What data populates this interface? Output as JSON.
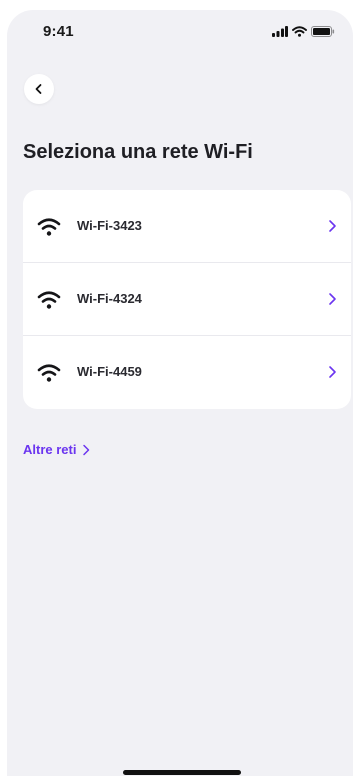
{
  "status_bar": {
    "time": "9:41",
    "icons": [
      "signal-icon",
      "wifi-icon",
      "battery-icon"
    ]
  },
  "header": {
    "back_icon": "chevron-left-icon",
    "title": "Seleziona una rete Wi-Fi"
  },
  "networks": [
    {
      "name": "Wi-Fi-3423",
      "icon": "wifi-icon",
      "action_icon": "chevron-right-icon"
    },
    {
      "name": "Wi-Fi-4324",
      "icon": "wifi-icon",
      "action_icon": "chevron-right-icon"
    },
    {
      "name": "Wi-Fi-4459",
      "icon": "wifi-icon",
      "action_icon": "chevron-right-icon"
    }
  ],
  "more_networks": {
    "label": "Altre reti",
    "icon": "chevron-right-icon"
  },
  "colors": {
    "background": "#f1f1f5",
    "card": "#ffffff",
    "accent": "#6b35f0",
    "text": "#1f1f24"
  }
}
